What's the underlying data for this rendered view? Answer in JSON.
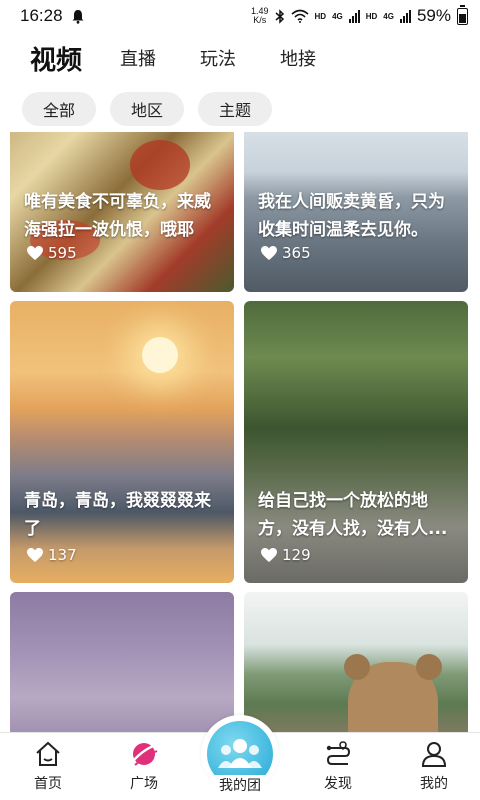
{
  "status_bar": {
    "time": "16:28",
    "net_speed_value": "1.49",
    "net_speed_unit": "K/s",
    "hd1": "HD",
    "hd2": "HD",
    "net1": "4G",
    "net2": "4G",
    "battery": "59%"
  },
  "top_tabs": [
    {
      "label": "视频",
      "active": true
    },
    {
      "label": "直播",
      "active": false
    },
    {
      "label": "玩法",
      "active": false
    },
    {
      "label": "地接",
      "active": false
    }
  ],
  "filters": [
    {
      "label": "全部"
    },
    {
      "label": "地区"
    },
    {
      "label": "主题"
    }
  ],
  "feed": [
    {
      "text": "唯有美食不可辜负，来威海强拉一波仇恨，哦耶",
      "likes": "595"
    },
    {
      "text": "我在人间贩卖黄昏，只为收集时间温柔去见你。",
      "likes": "365"
    },
    {
      "text": "青岛，青岛，我叕叕叕来了",
      "likes": "137"
    },
    {
      "text": "给自己找一个放松的地方，没有人找，没有人...",
      "likes": "129"
    },
    {
      "text": "",
      "likes": ""
    },
    {
      "text": "",
      "likes": ""
    }
  ],
  "bottom_nav": {
    "home": "首页",
    "square": "广场",
    "my_team": "我的团",
    "discover": "发现",
    "mine": "我的"
  },
  "colors": {
    "accent_square": "#e0307a",
    "team_circle": "#3db6dd"
  },
  "icons": [
    "bell-icon",
    "bluetooth-icon",
    "wifi-icon",
    "signal-icon",
    "battery-icon",
    "heart-icon",
    "home-icon",
    "square-icon",
    "team-icon",
    "discover-icon",
    "user-icon"
  ]
}
